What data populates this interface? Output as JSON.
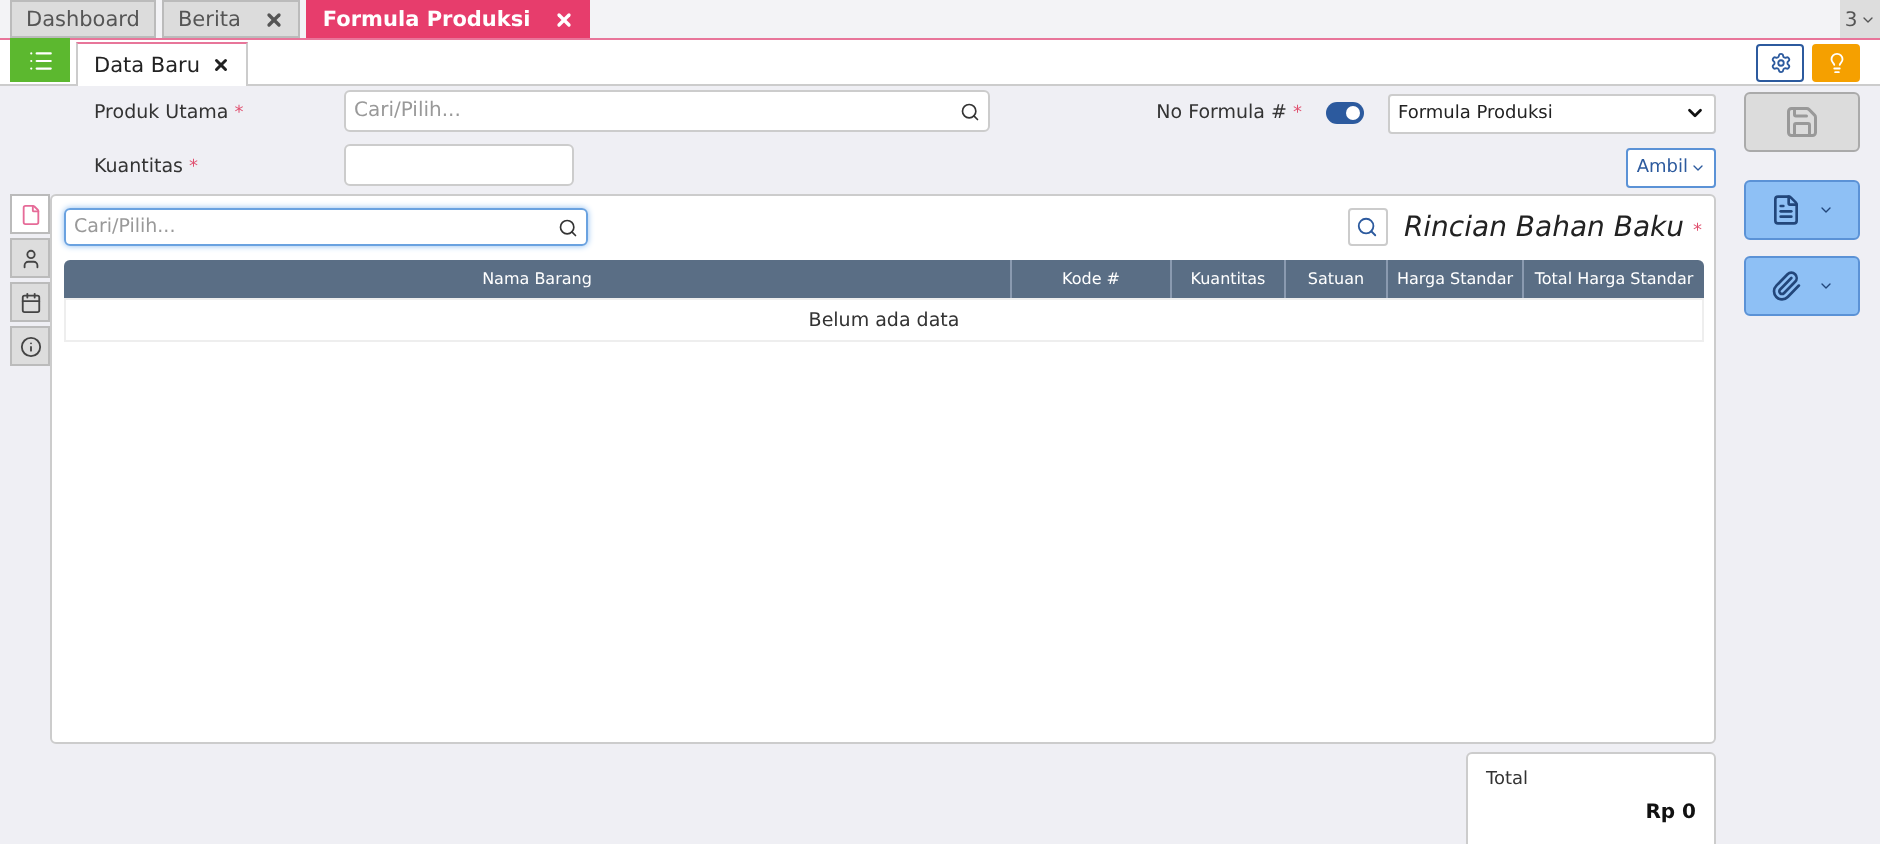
{
  "top_tabs": [
    {
      "label": "Dashboard",
      "closable": false,
      "selected": false
    },
    {
      "label": "Berita",
      "closable": true,
      "selected": false
    },
    {
      "label": "Formula Produksi",
      "closable": true,
      "selected": true
    }
  ],
  "tab_count": "3",
  "sub_tabs": [
    {
      "label": "Data Baru",
      "selected": true
    }
  ],
  "form": {
    "produk_utama": {
      "label": "Produk Utama",
      "required_mark": "*",
      "placeholder": "Cari/Pilih..."
    },
    "kuantitas": {
      "label": "Kuantitas",
      "required_mark": "*"
    },
    "no_formula": {
      "label": "No Formula #",
      "required_mark": "*",
      "toggle_on": true,
      "select_value": "Formula Produksi"
    },
    "ambil_button": "Ambil"
  },
  "side_tabs": [
    {
      "kind": "document",
      "selected": true
    },
    {
      "kind": "person",
      "selected": false
    },
    {
      "kind": "calendar",
      "selected": false
    },
    {
      "kind": "info",
      "selected": false
    }
  ],
  "panel": {
    "search_placeholder": "Cari/Pilih...",
    "title": "Rincian Bahan Baku",
    "required_mark": "*",
    "table": {
      "columns": [
        "Nama Barang",
        "Kode #",
        "Kuantitas",
        "Satuan",
        "Harga Standar",
        "Total Harga Standar"
      ],
      "empty_text": "Belum ada data"
    }
  },
  "total": {
    "label": "Total",
    "value": "Rp 0"
  }
}
